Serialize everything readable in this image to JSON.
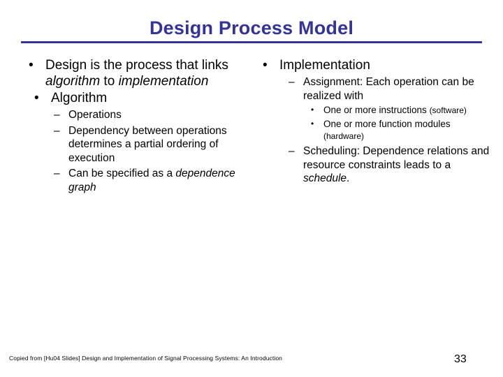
{
  "slide": {
    "title": "Design Process Model",
    "accent_color": "#333399",
    "background_color": "#ffffff",
    "text_color": "#000000"
  },
  "left_column": {
    "bullets": [
      {
        "level": 1,
        "marker": "•",
        "indent": false,
        "runs": [
          {
            "text": "Design is the process that links ",
            "italic": false
          },
          {
            "text": "algorithm",
            "italic": true
          },
          {
            "text": " to ",
            "italic": false
          },
          {
            "text": "implementation",
            "italic": true
          }
        ]
      },
      {
        "level": 1,
        "marker": "•",
        "indent": true,
        "runs": [
          {
            "text": "Algorithm",
            "italic": false
          }
        ]
      },
      {
        "level": 2,
        "marker": "–",
        "runs": [
          {
            "text": "Operations",
            "italic": false
          }
        ]
      },
      {
        "level": 2,
        "marker": "–",
        "runs": [
          {
            "text": "Dependency between operations determines a partial ordering of execution",
            "italic": false
          }
        ]
      },
      {
        "level": 2,
        "marker": "–",
        "runs": [
          {
            "text": "Can be specified as a ",
            "italic": false
          },
          {
            "text": "dependence graph",
            "italic": true
          }
        ]
      }
    ]
  },
  "right_column": {
    "bullets": [
      {
        "level": 1,
        "marker": "•",
        "indent": false,
        "runs": [
          {
            "text": "Implementation",
            "italic": false
          }
        ]
      },
      {
        "level": 2,
        "marker": "–",
        "runs": [
          {
            "text": "Assignment: Each operation can be realized with",
            "italic": false
          }
        ]
      },
      {
        "level": 3,
        "marker": "•",
        "runs": [
          {
            "text": "One or more instructions ",
            "italic": false,
            "small": false
          },
          {
            "text": "(software)",
            "italic": false,
            "small": true
          }
        ]
      },
      {
        "level": 3,
        "marker": "•",
        "runs": [
          {
            "text": "One or more function modules ",
            "italic": false,
            "small": false
          },
          {
            "text": "(hardware)",
            "italic": false,
            "small": true
          }
        ]
      },
      {
        "level": 2,
        "marker": "–",
        "runs": [
          {
            "text": "Scheduling: Dependence relations and resource constraints leads to a ",
            "italic": false
          },
          {
            "text": "schedule",
            "italic": true
          },
          {
            "text": ".",
            "italic": false
          }
        ]
      }
    ]
  },
  "footer": {
    "note": "Copied from  [Hu04 Slides] Design and Implementation of Signal Processing Systems: An Introduction",
    "page_number": "33"
  }
}
